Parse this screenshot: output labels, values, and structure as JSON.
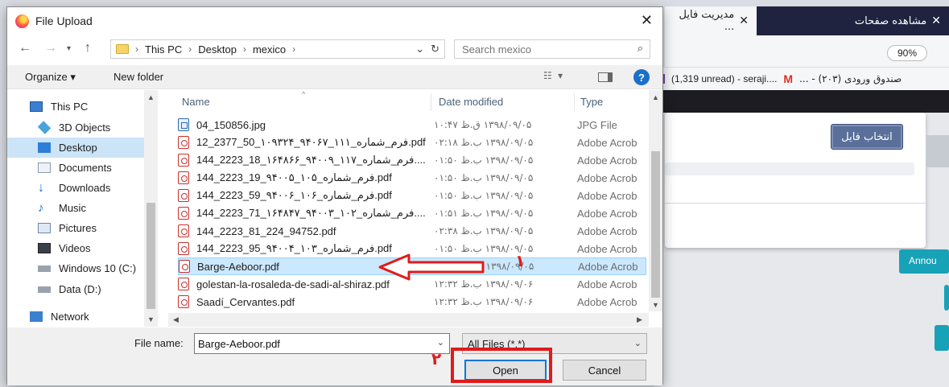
{
  "browser": {
    "tabs": [
      {
        "label": "مشاهده صفحات"
      },
      {
        "label": "مدیریت فایل ..."
      }
    ],
    "zoom": "90%",
    "bookmarks": [
      {
        "label": "صندوق ورودی (۲۰۳) - ..."
      },
      {
        "label": "(1,319 unread) - seraji...."
      }
    ],
    "upload_button": "انتخاب فایل",
    "side_button": "Annou"
  },
  "dialog": {
    "title": "File Upload",
    "breadcrumb": [
      "This PC",
      "Desktop",
      "mexico"
    ],
    "search_placeholder": "Search mexico",
    "toolbar": {
      "organize": "Organize ▾",
      "new_folder": "New folder"
    },
    "nav": [
      {
        "label": "This PC",
        "icon": "computer-icon"
      },
      {
        "label": "3D Objects",
        "icon": "cube-icon"
      },
      {
        "label": "Desktop",
        "icon": "desktop-icon"
      },
      {
        "label": "Documents",
        "icon": "document-icon"
      },
      {
        "label": "Downloads",
        "icon": "download-icon"
      },
      {
        "label": "Music",
        "icon": "music-icon"
      },
      {
        "label": "Pictures",
        "icon": "pictures-icon"
      },
      {
        "label": "Videos",
        "icon": "video-icon"
      },
      {
        "label": "Windows 10 (C:)",
        "icon": "drive-icon"
      },
      {
        "label": "Data (D:)",
        "icon": "drive-icon"
      },
      {
        "label": "Network",
        "icon": "network-icon"
      }
    ],
    "columns": {
      "name": "Name",
      "date": "Date modified",
      "type": "Type"
    },
    "files": [
      {
        "name": "04_150856.jpg",
        "date": "۱۳۹۸/۰۹/۰۵ ق.ظ ۱۰:۴۷",
        "type": "JPG File"
      },
      {
        "name": "12_2377_50_۱۰۹۳۲۴_۹۴۰۶۷_۱۱۱_فرم_شماره.pdf",
        "date": "۱۳۹۸/۰۹/۰۵ ب.ظ ۰۲:۱۸",
        "type": "Adobe Acrob"
      },
      {
        "name": "144_2223_18_۱۶۴۸۶۶_۹۴۰۰۹_۱۱۷_فرم_شماره....",
        "date": "۱۳۹۸/۰۹/۰۵ ب.ظ ۰۱:۵۰",
        "type": "Adobe Acrob"
      },
      {
        "name": "144_2223_19_۹۴۰۰۵_۱۰۵_فرم_شماره.pdf",
        "date": "۱۳۹۸/۰۹/۰۵ ب.ظ ۰۱:۵۰",
        "type": "Adobe Acrob"
      },
      {
        "name": "144_2223_59_۹۴۰۰۶_۱۰۶_فرم_شماره.pdf",
        "date": "۱۳۹۸/۰۹/۰۵ ب.ظ ۰۱:۵۰",
        "type": "Adobe Acrob"
      },
      {
        "name": "144_2223_71_۱۶۴۸۴۷_۹۴۰۰۳_۱۰۲_فرم_شماره....",
        "date": "۱۳۹۸/۰۹/۰۵ ب.ظ ۰۱:۵۱",
        "type": "Adobe Acrob"
      },
      {
        "name": "144_2223_81_224_94752.pdf",
        "date": "۱۳۹۸/۰۹/۰۵ ب.ظ ۰۲:۳۸",
        "type": "Adobe Acrob"
      },
      {
        "name": "144_2223_95_۹۴۰۰۴_۱۰۳_فرم_شماره.pdf",
        "date": "۱۳۹۸/۰۹/۰۵ ب.ظ ۰۱:۵۰",
        "type": "Adobe Acrob"
      },
      {
        "name": "Barge-Aeboor.pdf",
        "date": "۱۳۹۸/۰۹/۰۵ ب.ظ ۰۱:۳۳",
        "type": "Adobe Acrob"
      },
      {
        "name": "golestan-la-rosaleda-de-sadi-al-shiraz.pdf",
        "date": "۱۳۹۸/۰۹/۰۶ ب.ظ ۱۲:۳۲",
        "type": "Adobe Acrob"
      },
      {
        "name": "Saadí_Cervantes.pdf",
        "date": "۱۳۹۸/۰۹/۰۶ ب.ظ ۱۲:۳۲",
        "type": "Adobe Acrob"
      }
    ],
    "file_name_label": "File name:",
    "file_name_value": "Barge-Aeboor.pdf",
    "file_type": "All Files (*.*)",
    "open_label": "Open",
    "cancel_label": "Cancel"
  },
  "annotations": {
    "step1": "۱",
    "step2": "۲",
    "color": "#e01b1b"
  }
}
